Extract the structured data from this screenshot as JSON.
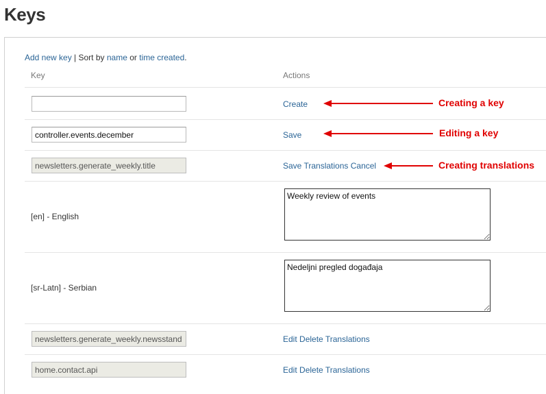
{
  "page": {
    "title": "Keys"
  },
  "toolbar": {
    "add_new_key": "Add new key",
    "sep": " | Sort by ",
    "sort_name": "name",
    "or_text": " or ",
    "sort_time": "time created",
    "period": "."
  },
  "table": {
    "headers": {
      "key": "Key",
      "actions": "Actions"
    },
    "rows": [
      {
        "key_value": "",
        "actions": [
          "Create"
        ]
      },
      {
        "key_value": "controller.events.december",
        "actions": [
          "Save"
        ]
      },
      {
        "key_value": "newsletters.generate_weekly.title",
        "actions": [
          "Save Translations",
          "Cancel"
        ]
      },
      {
        "lang_label": "[en] - English",
        "translation": "Weekly review of events"
      },
      {
        "lang_label": "[sr-Latn] - Serbian",
        "translation": "Nedeljni pregled događaja"
      },
      {
        "key_value": "newsletters.generate_weekly.newsstand",
        "actions": [
          "Edit",
          "Delete",
          "Translations"
        ]
      },
      {
        "key_value": "home.contact.api",
        "actions": [
          "Edit",
          "Delete",
          "Translations"
        ]
      }
    ]
  },
  "annotations": [
    {
      "text": "Creating a key",
      "color": "#e00000"
    },
    {
      "text": "Editing a key",
      "color": "#e00000"
    },
    {
      "text": "Creating translations",
      "color": "#e00000"
    }
  ],
  "colors": {
    "link": "#2a6496",
    "annotation": "#e00000"
  }
}
